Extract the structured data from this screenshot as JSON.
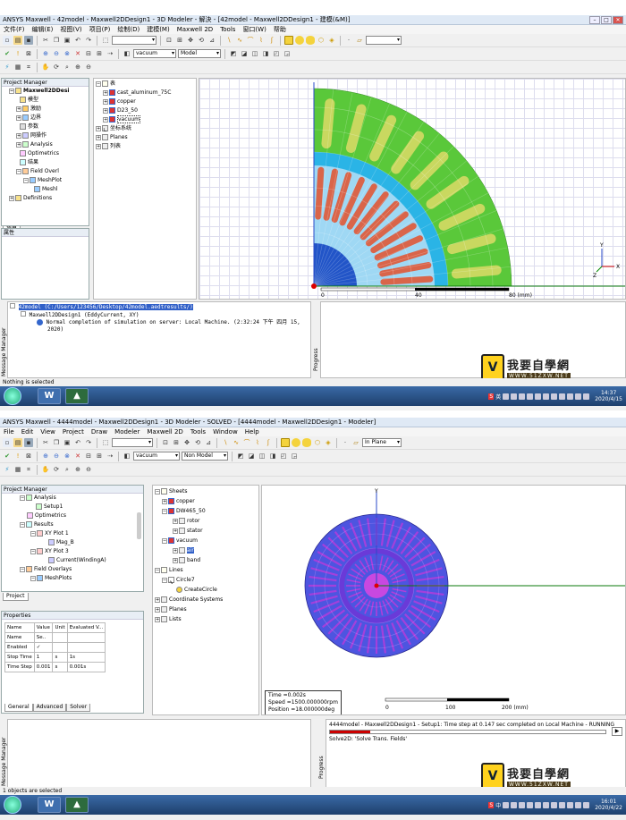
{
  "w1": {
    "title": "ANSYS Maxwell - 42model - Maxwell2DDesign1 - 3D Modeler - 解決 - [42model - Maxwell2DDesign1 - 建模(&M)]",
    "menu": [
      "文件(F)",
      "编辑(E)",
      "视图(V)",
      "项目(P)",
      "绘制(D)",
      "建模(M)",
      "Maxwell 2D",
      "Tools",
      "窗口(W)",
      "帮助"
    ],
    "material_dd": "vacuum",
    "model_dd": "Model",
    "project_manager": "Project Manager",
    "project_tree": [
      "Maxwell2DDesi",
      "模型",
      "激励",
      "边界",
      "参数",
      "网操作",
      "Analysis",
      "Optimetrics",
      "结果",
      "Field Overl",
      "MeshPlot",
      "Meshl",
      "Definitions"
    ],
    "tab_project": "项目",
    "properties": "属性",
    "model_tree": [
      "表",
      "cast_aluminum_75C",
      "copper",
      "D23_50",
      "vacuum",
      "坐标系统",
      "Planes",
      "列表"
    ],
    "axis_ticks": [
      "0",
      "40",
      "80 (mm)"
    ],
    "axis_labels": [
      "X",
      "Y",
      "Z"
    ],
    "msg_line1": "42model (C:/Users/123456/Desktop/42model.aedtresults/)",
    "msg_line2": "Maxwell2DDesign1 (EddyCurrent, XY)",
    "msg_line3": "Normal completion of simulation on server: Local Machine. (2:32:24 下午  四月 15,",
    "msg_line4": "2020)",
    "msg_label": "Message Manager",
    "progress_label": "Progress",
    "status": "Nothing is selected",
    "clock_time": "14:37",
    "clock_date": "2020/4/15",
    "tray_lang": "英"
  },
  "w2": {
    "title": "ANSYS Maxwell - 4444model - Maxwell2DDesign1 - 3D Modeler - SOLVED - [4444model - Maxwell2DDesign1 - Modeler]",
    "menu": [
      "File",
      "Edit",
      "View",
      "Project",
      "Draw",
      "Modeler",
      "Maxwell 2D",
      "Tools",
      "Window",
      "Help"
    ],
    "plane_dd": "In Plane",
    "material_dd": "vacuum",
    "model_dd": "Non Model",
    "project_manager": "Project Manager",
    "project_tree": [
      "Analysis",
      "Setup1",
      "Optimetrics",
      "Results",
      "XY Plot 1",
      "Mag_B",
      "XY Plot 3",
      "Current(WindingA)",
      "Field Overlays",
      "MeshPlots"
    ],
    "tab_project": "Project",
    "properties": "Properties",
    "prop_headers": [
      "Name",
      "Value",
      "Unit",
      "Evaluated V..."
    ],
    "prop_rows": [
      [
        "Name",
        "Se..",
        "",
        ""
      ],
      [
        "Enabled",
        "✓",
        "",
        ""
      ],
      [
        "Stop Time",
        "1",
        "s",
        "1s"
      ],
      [
        "Time Step",
        "0.001",
        "s",
        "0.001s"
      ]
    ],
    "prop_tabs": [
      "General",
      "Advanced",
      "Solver"
    ],
    "model_tree": [
      "Sheets",
      "copper",
      "DW465_50",
      "rotor",
      "stator",
      "vacuum",
      "air",
      "band",
      "Lines",
      "Circle7",
      "CreateCircle",
      "Coordinate Systems",
      "Planes",
      "Lists"
    ],
    "axis_label_y": "Y",
    "axis_ticks": [
      "0",
      "100",
      "200 (mm)"
    ],
    "overlay_time": "Time      =0.002s",
    "overlay_speed": "Speed    =1500.000000rpm",
    "overlay_position": "Position =18.000000deg",
    "progress_msg": "4444model - Maxwell2DDesign1 - Setup1: Time step at 0.147 sec completed on Local Machine - RUNNING",
    "progress_solve": "Solve2D: 'Solve Trans. Fields'",
    "progress_fraction": 0.147,
    "msg_label": "Message Manager",
    "progress_label": "Progress",
    "status": "1 objects are selected",
    "clock_time": "16:01",
    "clock_date": "2020/4/22",
    "tray_lang": "中"
  },
  "logo": {
    "zh": "我要自學網",
    "url": "WWW.51ZXW.NET"
  },
  "colors": {
    "mesh_green": "#5ac83a",
    "mesh_cyan": "#2ab4e6",
    "slot_red": "#d9654a",
    "disk_blue": "#4d55e0",
    "disk_magenta": "#c838d8",
    "axis_green": "#0a7a0a",
    "progress_red": "#cc0000"
  }
}
